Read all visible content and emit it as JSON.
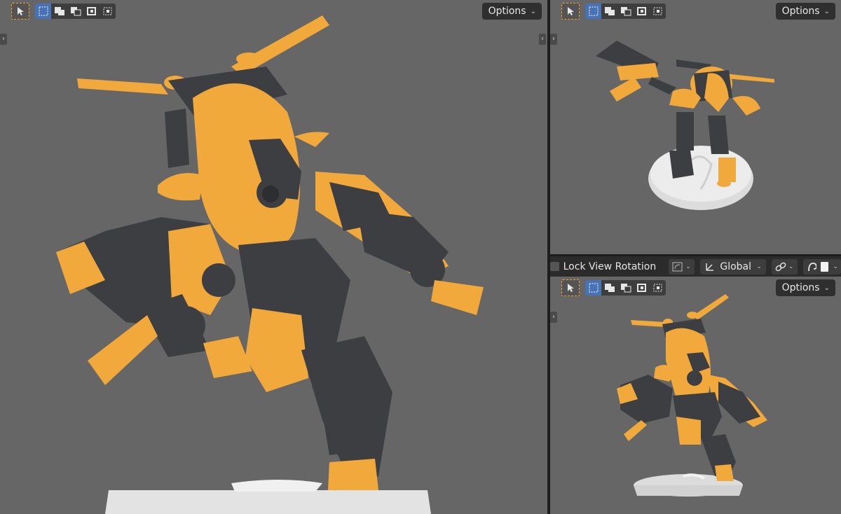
{
  "colors": {
    "viewport_bg": "#666666",
    "robot_orange": "#f2a93b",
    "robot_dark": "#3c3e42",
    "base_white": "#e6e6e6",
    "active_blue": "#4772b3",
    "select_dash": "#f0a030"
  },
  "viewports": {
    "main": {
      "options_label": "Options"
    },
    "top_right": {
      "options_label": "Options"
    },
    "bottom_right": {
      "options_label": "Options"
    }
  },
  "toolbar_icons": [
    "select-cursor-icon",
    "select-new-icon",
    "select-extend-icon",
    "select-subtract-icon",
    "select-invert-icon"
  ],
  "header_bar": {
    "lock_view_rotation_label": "Lock View Rotation",
    "orientation_value": "Global"
  }
}
